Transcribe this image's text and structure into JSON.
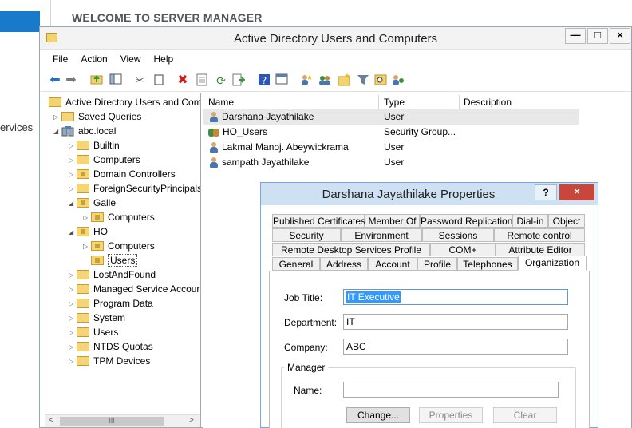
{
  "background": {
    "title": "WELCOME TO SERVER MANAGER",
    "left_fragment": "ervices"
  },
  "window": {
    "title": "Active Directory Users and Computers",
    "controls": {
      "minimize": "—",
      "maximize": "□",
      "close": "×"
    }
  },
  "menu": [
    "File",
    "Action",
    "View",
    "Help"
  ],
  "toolbar_icons": [
    "back-arrow-icon",
    "forward-arrow-icon",
    "up-folder-icon",
    "show-console-tree-icon",
    "cut-icon",
    "copy-icon",
    "delete-icon",
    "properties-icon",
    "refresh-icon",
    "export-list-icon",
    "help-icon",
    "console-icon",
    "new-user-icon",
    "new-group-icon",
    "new-ou-icon",
    "filter-icon",
    "find-icon",
    "add-to-group-icon"
  ],
  "tree": {
    "root": "Active Directory Users and Com",
    "items": [
      {
        "label": "Saved Queries",
        "expander": "▷"
      },
      {
        "label": "abc.local",
        "expander": "◢"
      },
      {
        "label": "Builtin",
        "expander": "▷"
      },
      {
        "label": "Computers",
        "expander": "▷"
      },
      {
        "label": "Domain Controllers",
        "expander": "▷"
      },
      {
        "label": "ForeignSecurityPrincipals",
        "expander": "▷"
      },
      {
        "label": "Galle",
        "expander": "◢"
      },
      {
        "label": "Computers",
        "expander": "▷"
      },
      {
        "label": "HO",
        "expander": "◢"
      },
      {
        "label": "Computers",
        "expander": "▷"
      },
      {
        "label": "Users",
        "expander": ""
      },
      {
        "label": "LostAndFound",
        "expander": "▷"
      },
      {
        "label": "Managed Service Accour",
        "expander": "▷"
      },
      {
        "label": "Program Data",
        "expander": "▷"
      },
      {
        "label": "System",
        "expander": "▷"
      },
      {
        "label": "Users",
        "expander": "▷"
      },
      {
        "label": "NTDS Quotas",
        "expander": "▷"
      },
      {
        "label": "TPM Devices",
        "expander": "▷"
      }
    ],
    "scroll_left": "<",
    "scroll_thumb": "III",
    "scroll_right": ">"
  },
  "list": {
    "columns": [
      "Name",
      "Type",
      "Description"
    ],
    "rows": [
      {
        "name": "Darshana Jayathilake",
        "type": "User"
      },
      {
        "name": "HO_Users",
        "type": "Security Group..."
      },
      {
        "name": "Lakmal Manoj. Abeywickrama",
        "type": "User"
      },
      {
        "name": "sampath Jayathilake",
        "type": "User"
      }
    ]
  },
  "dialog": {
    "title": "Darshana Jayathilake Properties",
    "help": "?",
    "close": "×",
    "tabs_row1": [
      "Published Certificates",
      "Member Of",
      "Password Replication",
      "Dial-in",
      "Object"
    ],
    "tabs_row2": [
      "Security",
      "Environment",
      "Sessions",
      "Remote control"
    ],
    "tabs_row3": [
      "Remote Desktop Services Profile",
      "COM+",
      "Attribute Editor"
    ],
    "tabs_row4": [
      "General",
      "Address",
      "Account",
      "Profile",
      "Telephones",
      "Organization"
    ],
    "job_title_label": "Job Title:",
    "job_title_value": "IT Executive",
    "department_label": "Department:",
    "department_value": "IT",
    "company_label": "Company:",
    "company_value": "ABC",
    "manager_group": "Manager",
    "name_label": "Name:",
    "name_value": "",
    "change_button": "Change...",
    "properties_button": "Properties",
    "clear_button": "Clear"
  }
}
